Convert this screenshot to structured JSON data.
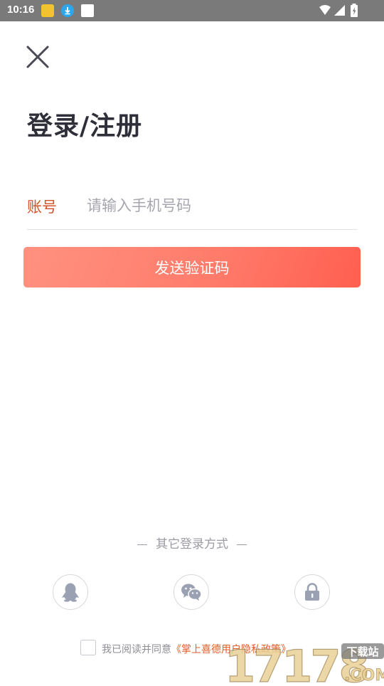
{
  "status_bar": {
    "time": "10:16"
  },
  "header": {
    "title": "登录/注册"
  },
  "form": {
    "account_label": "账号",
    "phone_placeholder": "请输入手机号码",
    "phone_value": "",
    "send_code_label": "发送验证码"
  },
  "other_login": {
    "label": "其它登录方式",
    "methods": [
      "qq-icon",
      "wechat-icon",
      "lock-icon"
    ]
  },
  "agreement": {
    "prefix": "我已阅读并同意",
    "link": "《掌上喜德用户隐私政策》",
    "checked": false
  },
  "watermark": {
    "main": "17178",
    "sub": ".COM",
    "badge": "下载站"
  },
  "colors": {
    "accent": "#d2512b",
    "button_start": "#ff9180",
    "button_end": "#ff5f4f",
    "status_bar": "#7a7a7a"
  }
}
